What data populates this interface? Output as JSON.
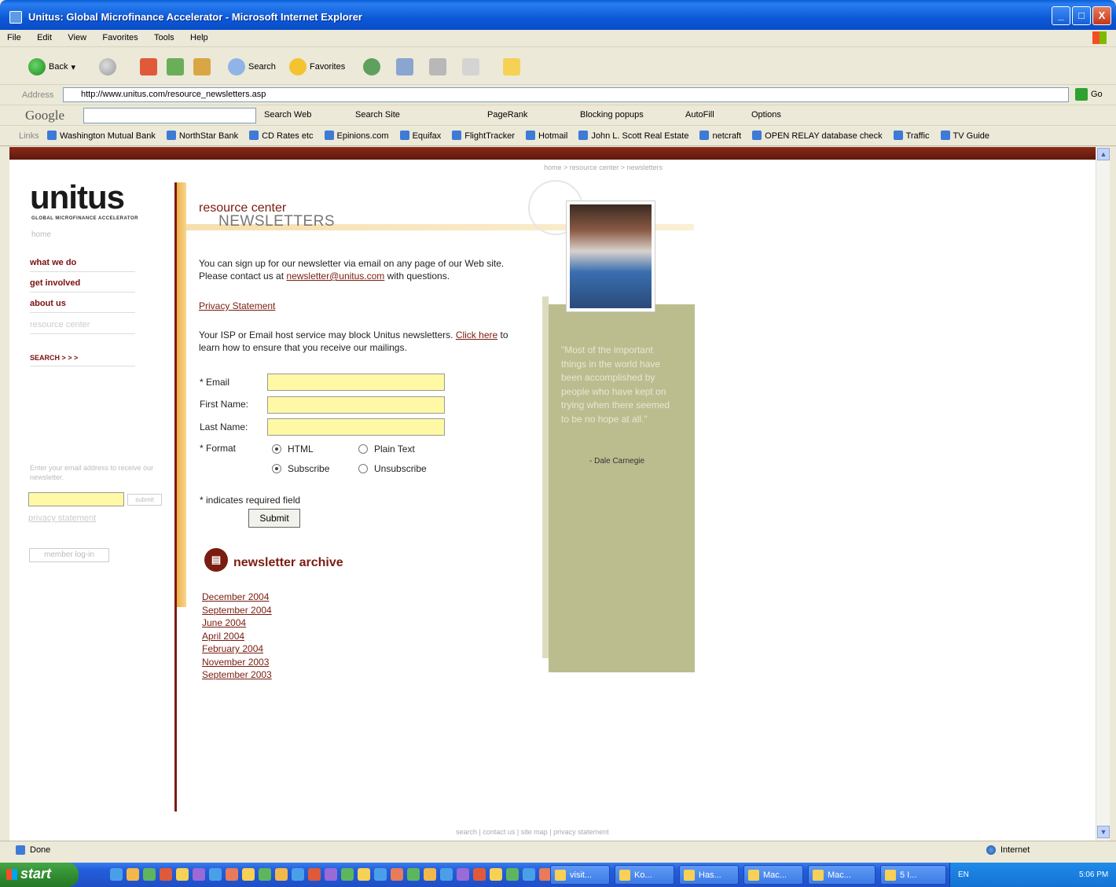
{
  "window": {
    "title": "Unitus: Global Microfinance Accelerator - Microsoft Internet Explorer",
    "buttons": [
      "_",
      "□",
      "X"
    ]
  },
  "menu": [
    "File",
    "Edit",
    "View",
    "Favorites",
    "Tools",
    "Help"
  ],
  "toolbar": {
    "back": "Back",
    "search": "Search",
    "favorites": "Favorites"
  },
  "address": {
    "label": "Address",
    "url": "http://www.unitus.com/resource_newsletters.asp",
    "go": "Go"
  },
  "google": {
    "logo": "Google",
    "search_web": "Search Web",
    "search_site": "Search Site",
    "pagerank": "PageRank",
    "blocking": "Blocking popups",
    "autofill": "AutoFill",
    "options": "Options"
  },
  "links": {
    "label": "Links",
    "items": [
      "Washington Mutual Bank",
      "NorthStar Bank",
      "CD Rates etc",
      "Epinions.com",
      "Equifax",
      "FlightTracker",
      "Hotmail",
      "John L. Scott Real Estate",
      "netcraft",
      "OPEN RELAY database check",
      "Traffic",
      "TV Guide"
    ]
  },
  "page": {
    "breadcrumb": "home > resource center > newsletters",
    "logo": "unitus",
    "logo_sub": "GLOBAL MICROFINANCE ACCELERATOR",
    "home": "home",
    "nav": [
      "what we do",
      "get involved",
      "about us",
      "resource center"
    ],
    "search": "SEARCH > > >",
    "email_tip": "Enter your email address to receive our newsletter.",
    "side_submit": "submit",
    "side_privacy": "privacy statement",
    "member_login": "member log-in",
    "section_title": "resource center",
    "page_title": "NEWSLETTERS",
    "intro_pre": "You can sign up for our newsletter via email on any page of our Web site. Please contact us at ",
    "intro_email": "newsletter@unitus.com",
    "intro_post": " with questions.",
    "privacy_statement": "Privacy Statement",
    "isp_pre": "Your ISP or Email host service may block Unitus newsletters. ",
    "isp_link": "Click here",
    "isp_post": " to learn how to ensure that you receive our mailings.",
    "form": {
      "email_label": "* Email",
      "first_label": "First Name:",
      "last_label": "Last Name:",
      "format_label": "* Format",
      "html": "HTML",
      "plain": "Plain Text",
      "subscribe": "Subscribe",
      "unsubscribe": "Unsubscribe",
      "required_note": "* indicates required field",
      "submit": "Submit"
    },
    "archive_title": "newsletter archive",
    "archive": [
      "December 2004",
      "September 2004",
      "June 2004",
      "April 2004",
      "February 2004",
      "November 2003",
      "September 2003"
    ],
    "quote": "\"Most of the important things in the world have been accomplished by people who have kept on trying when there seemed to be no hope at all.\"",
    "quote_author": "- Dale Carnegie",
    "footer": "search | contact us | site map | privacy statement"
  },
  "status": {
    "left": "Done",
    "right": "Internet"
  },
  "taskbar": {
    "start": "start",
    "tasks": [
      "visit...",
      "Ko...",
      "Has...",
      "Mac...",
      "Mac...",
      "5 I..."
    ],
    "lang": "EN",
    "clock": "5:06 PM"
  }
}
